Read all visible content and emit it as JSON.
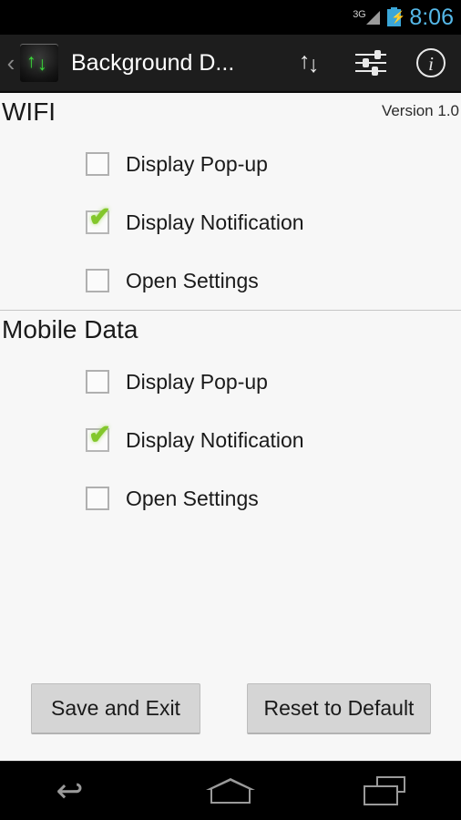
{
  "status_bar": {
    "network_type": "3G",
    "signal_icon": "signal-triangle-icon",
    "battery_icon": "battery-charging-icon",
    "battery_bolt": "⚡",
    "clock": "8:06",
    "clock_color": "#55b8e8"
  },
  "action_bar": {
    "up_caret": "‹",
    "app_icon": "background-data-app-icon",
    "arrow_up": "↑",
    "arrow_down": "↓",
    "title": "Background D...",
    "actions": [
      {
        "name": "data-transfer-icon",
        "label": "Data Transfer"
      },
      {
        "name": "sliders-icon",
        "label": "Settings"
      },
      {
        "name": "info-icon",
        "label": "i"
      }
    ]
  },
  "content": {
    "version": "Version 1.0",
    "sections": [
      {
        "title": "WIFI",
        "options": [
          {
            "label": "Display Pop-up",
            "checked": false
          },
          {
            "label": "Display Notification",
            "checked": true
          },
          {
            "label": "Open Settings",
            "checked": false
          }
        ]
      },
      {
        "title": "Mobile Data",
        "options": [
          {
            "label": "Display Pop-up",
            "checked": false
          },
          {
            "label": "Display Notification",
            "checked": true
          },
          {
            "label": "Open Settings",
            "checked": false
          }
        ]
      }
    ],
    "check_glyph": "✔",
    "check_color": "#83c72b"
  },
  "buttons": {
    "save": "Save and Exit",
    "reset": "Reset to Default"
  },
  "nav_bar": {
    "back": "↩",
    "home": "home-icon",
    "recents": "recents-icon"
  }
}
